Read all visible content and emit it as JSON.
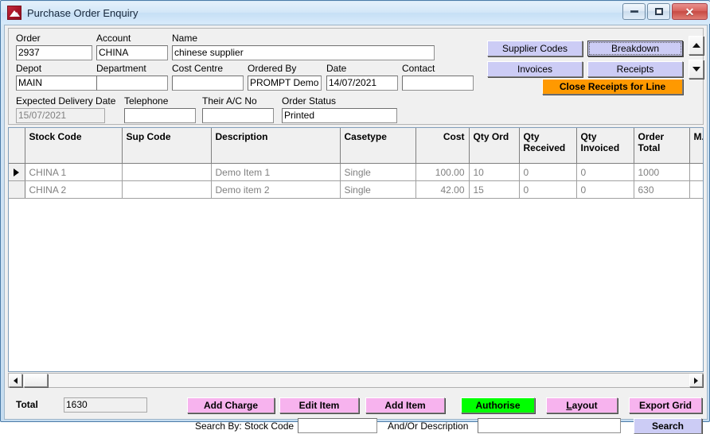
{
  "window": {
    "title": "Purchase Order Enquiry",
    "app_icon": "mountain-logo-icon",
    "minimize_label": "",
    "maximize_label": "",
    "close_label": "✕"
  },
  "header_form": {
    "fields": [
      {
        "label": "Order",
        "value": "2937",
        "readonly": false
      },
      {
        "label": "Account",
        "value": "CHINA",
        "readonly": false
      },
      {
        "label": "Name",
        "value": "chinese supplier",
        "readonly": false
      },
      {
        "label": "Depot",
        "value": "MAIN",
        "readonly": false
      },
      {
        "label": "Department",
        "value": "",
        "readonly": false
      },
      {
        "label": "Cost Centre",
        "value": "",
        "readonly": false
      },
      {
        "label": "Ordered By",
        "value": "PROMPT Demo",
        "readonly": false
      },
      {
        "label": "Date",
        "value": "14/07/2021",
        "readonly": false
      },
      {
        "label": "Contact",
        "value": "",
        "readonly": false
      },
      {
        "label": "Expected Delivery Date",
        "value": "15/07/2021",
        "readonly": true
      },
      {
        "label": "Telephone",
        "value": "",
        "readonly": false
      },
      {
        "label": "Their A/C No",
        "value": "",
        "readonly": false
      },
      {
        "label": "Order Status",
        "value": "Printed",
        "readonly": false
      }
    ]
  },
  "action_buttons": [
    {
      "label": "Supplier Codes",
      "style": "lavender",
      "focused": false
    },
    {
      "label": "Breakdown",
      "style": "lavender",
      "focused": true
    },
    {
      "label": "Invoices",
      "style": "lavender",
      "focused": false
    },
    {
      "label": "Receipts",
      "style": "lavender",
      "focused": false
    },
    {
      "label": "Close Receipts for Line",
      "style": "orange",
      "focused": false
    }
  ],
  "spinner": {
    "up_icon": "triangle-up-icon",
    "down_icon": "triangle-down-icon"
  },
  "grid": {
    "columns": [
      {
        "label": "",
        "align": "left"
      },
      {
        "label": "Stock Code",
        "align": "left"
      },
      {
        "label": "Sup Code",
        "align": "left"
      },
      {
        "label": "Description",
        "align": "left"
      },
      {
        "label": "Casetype",
        "align": "left"
      },
      {
        "label": "Cost",
        "align": "right"
      },
      {
        "label": "Qty Ord",
        "align": "left"
      },
      {
        "label": "Qty\nReceived",
        "align": "left"
      },
      {
        "label": "Qty\nInvoiced",
        "align": "left"
      },
      {
        "label": "Order\nTotal",
        "align": "left"
      },
      {
        "label": "M.",
        "align": "left"
      }
    ],
    "rows": [
      {
        "selected": true,
        "cells": [
          "",
          "CHINA 1",
          "",
          "Demo Item 1",
          "Single",
          "100.00",
          "10",
          "0",
          "0",
          "1000",
          ""
        ]
      },
      {
        "selected": false,
        "cells": [
          "",
          "CHINA 2",
          "",
          "Demo item 2",
          "Single",
          "42.00",
          "15",
          "0",
          "0",
          "630",
          ""
        ]
      }
    ]
  },
  "hscroll": {
    "left_icon": "arrow-left-icon",
    "right_icon": "arrow-right-icon"
  },
  "footer": {
    "total_label": "Total",
    "total_value": "1630",
    "buttons": [
      {
        "label": "Add Charge",
        "style": "pink",
        "accel": ""
      },
      {
        "label": "Edit Item",
        "style": "pink",
        "accel": ""
      },
      {
        "label": "Add Item",
        "style": "pink",
        "accel": ""
      },
      {
        "label": "Authorise",
        "style": "green",
        "accel": "A"
      },
      {
        "label": "Layout",
        "style": "pink",
        "accel": "L"
      },
      {
        "label": "Export Grid",
        "style": "pink",
        "accel": ""
      }
    ],
    "search_by_label": "Search By: Stock Code",
    "search_by_value": "",
    "and_or_label": "And/Or Description",
    "and_or_value": "",
    "search_button_label": "Search"
  },
  "colors": {
    "lavender_button": "#ccccf5",
    "pink_button": "#f7b3ee",
    "green_button": "#00ff00",
    "orange_button": "#ff9900",
    "window_frame": "#4a7ba8",
    "grid_text": "#808080"
  }
}
